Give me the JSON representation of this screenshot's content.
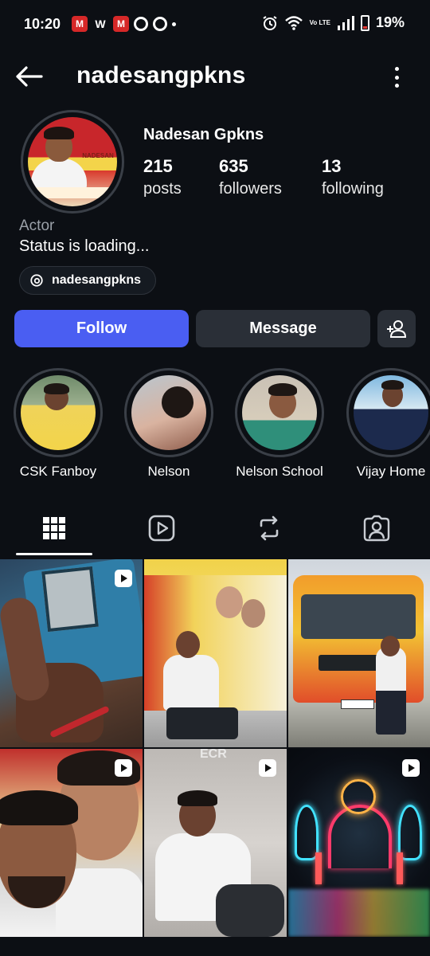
{
  "status_bar": {
    "time": "10:20",
    "battery_text": "19%",
    "battery_level": 0.19,
    "notification_icons": [
      "gmail-icon",
      "w-app-icon",
      "gmail-icon",
      "chat-icon",
      "ring-icon",
      "dot"
    ],
    "network": "Vo LTE",
    "accent_battery": "#e53935"
  },
  "header": {
    "username": "nadesangpkns"
  },
  "profile": {
    "display_name": "Nadesan Gpkns",
    "stats": [
      {
        "value": "215",
        "label": "posts"
      },
      {
        "value": "635",
        "label": "followers"
      },
      {
        "value": "13",
        "label": "following"
      }
    ],
    "category": "Actor",
    "bio": "Status is loading...",
    "threads_handle": "nadesangpkns",
    "avatar_text": "NADESAN"
  },
  "actions": {
    "follow_label": "Follow",
    "message_label": "Message",
    "follow_color": "#4a5ef2"
  },
  "highlights": [
    {
      "label": "CSK Fanboy"
    },
    {
      "label": "Nelson"
    },
    {
      "label": "Nelson School"
    },
    {
      "label": "Vijay Home"
    }
  ],
  "tabs": [
    {
      "name": "grid-icon",
      "active": true
    },
    {
      "name": "reels-icon",
      "active": false
    },
    {
      "name": "reposts-icon",
      "active": false
    },
    {
      "name": "tagged-icon",
      "active": false
    }
  ],
  "posts": [
    {
      "type": "reel"
    },
    {
      "type": "photo"
    },
    {
      "type": "photo"
    },
    {
      "type": "reel"
    },
    {
      "type": "reel",
      "watermark": "ECR"
    },
    {
      "type": "reel"
    }
  ]
}
